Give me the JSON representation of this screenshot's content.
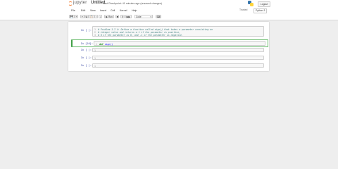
{
  "header": {
    "logo_text": "jupyter",
    "notebook_title": "Untitled",
    "checkpoint": "Last Checkpoint: 41 minutes ago  (unsaved changes)",
    "logout_label": "Logout"
  },
  "menubar": {
    "items": [
      "File",
      "Edit",
      "View",
      "Insert",
      "Cell",
      "Kernel",
      "Help"
    ],
    "trusted_label": "Trusted",
    "kernel_name": "Python 3"
  },
  "toolbar": {
    "save_icon": "💾",
    "add_icon": "+",
    "cut_icon": "✂",
    "copy_icon": "⧉",
    "paste_icon": "📋",
    "up_icon": "↑",
    "down_icon": "↓",
    "run_icon": "▶",
    "run_label": "Run",
    "stop_icon": "■",
    "restart_icon": "↻",
    "rerun_icon": "▶▶",
    "cell_type": "Code",
    "keyboard_icon": "⌨"
  },
  "cells": [
    {
      "prompt": "In [ ]:",
      "lines": [
        "# Define a function called sign() that takes a parameter consisting an",
        "# integer value and returns a 1 if the parameter is positive,",
        "# 0 if the parameter is 0, and -1 if the parameter is negative."
      ]
    },
    {
      "prompt": "In [10]:",
      "lines": [
        "def sign()"
      ]
    },
    {
      "prompt": "In [ ]:",
      "lines": [
        ""
      ]
    },
    {
      "prompt": "In [ ]:",
      "lines": [
        ""
      ]
    },
    {
      "prompt": "In [ ]:",
      "lines": [
        ""
      ]
    }
  ],
  "cell0_comment_prefix": "# Problem 1.7.4: Define a function called sign() that takes a parameter consisting an",
  "cell0_line_numbers": [
    "1",
    "2",
    "3"
  ],
  "cell1_line_number": "1",
  "cell1_keyword": "def",
  "cell1_fn": "sign()"
}
